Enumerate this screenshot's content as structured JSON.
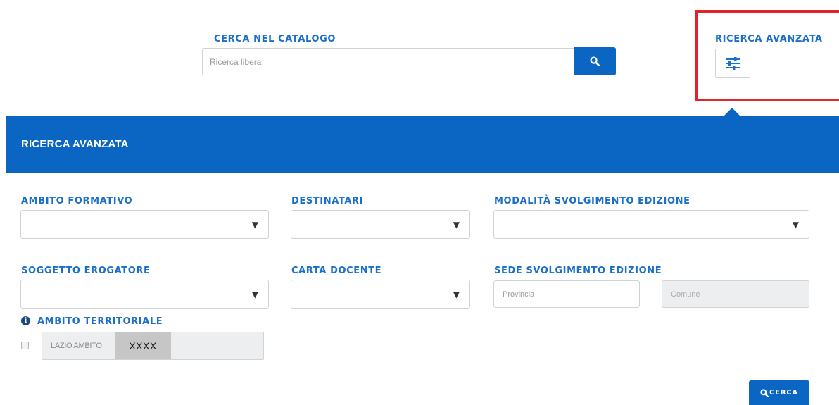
{
  "search": {
    "label": "CERCA NEL CATALOGO",
    "placeholder": "Ricerca libera"
  },
  "advanced_toggle": {
    "label": "RICERCA AVANZATA"
  },
  "advanced_panel": {
    "title": "RICERCA AVANZATA"
  },
  "filters": {
    "ambito_formativo": {
      "label": "AMBITO FORMATIVO",
      "value": ""
    },
    "destinatari": {
      "label": "DESTINATARI",
      "value": ""
    },
    "modalita": {
      "label": "MODALITÀ SVOLGIMENTO EDIZIONE",
      "value": ""
    },
    "soggetto_erogatore": {
      "label": "SOGGETTO EROGATORE",
      "value": ""
    },
    "carta_docente": {
      "label": "CARTA DOCENTE",
      "value": ""
    },
    "sede": {
      "label": "SEDE SVOLGIMENTO EDIZIONE",
      "provincia_placeholder": "Provincia",
      "comune_placeholder": "Comune"
    }
  },
  "territory": {
    "label": "AMBITO TERRITORIALE",
    "option_text": "LAZIO AMBITO",
    "redacted_text": "XXXX",
    "checked": false
  },
  "submit": {
    "label": "CERCA"
  },
  "icons": {
    "caret": "▼",
    "info": "i"
  },
  "colors": {
    "primary": "#0a66c2",
    "label_blue": "#1a6fc9",
    "highlight_red": "#e3222a"
  }
}
